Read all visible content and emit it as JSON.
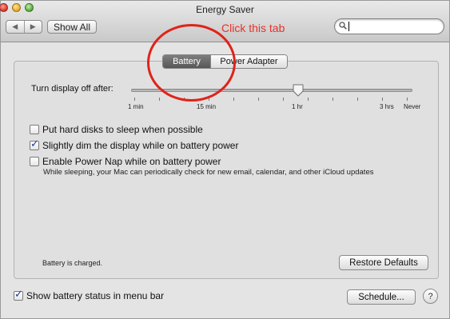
{
  "window": {
    "title": "Energy Saver",
    "nav_back": "◀",
    "nav_forward": "▶",
    "show_all": "Show All",
    "search": {
      "value": "",
      "placeholder": ""
    }
  },
  "annotation": {
    "text": "Click this tab",
    "color": "#e8312a"
  },
  "tabs": [
    {
      "label": "Battery",
      "selected": true
    },
    {
      "label": "Power Adapter",
      "selected": false
    }
  ],
  "display_sleep": {
    "label": "Turn display off after:",
    "value_label": "1 hr",
    "tick_labels": [
      "1 min",
      "15 min",
      "1 hr",
      "3 hrs",
      "Never"
    ]
  },
  "options": [
    {
      "label": "Put hard disks to sleep when possible",
      "checked": false
    },
    {
      "label": "Slightly dim the display while on battery power",
      "checked": true
    },
    {
      "label": "Enable Power Nap while on battery power",
      "checked": false
    }
  ],
  "power_nap_note": "While sleeping, your Mac can periodically check for new email, calendar, and other iCloud updates",
  "status_text": "Battery is charged.",
  "buttons": {
    "restore_defaults": "Restore Defaults",
    "schedule": "Schedule...",
    "help": "?"
  },
  "show_battery_status": {
    "label": "Show battery status in menu bar",
    "checked": true
  }
}
